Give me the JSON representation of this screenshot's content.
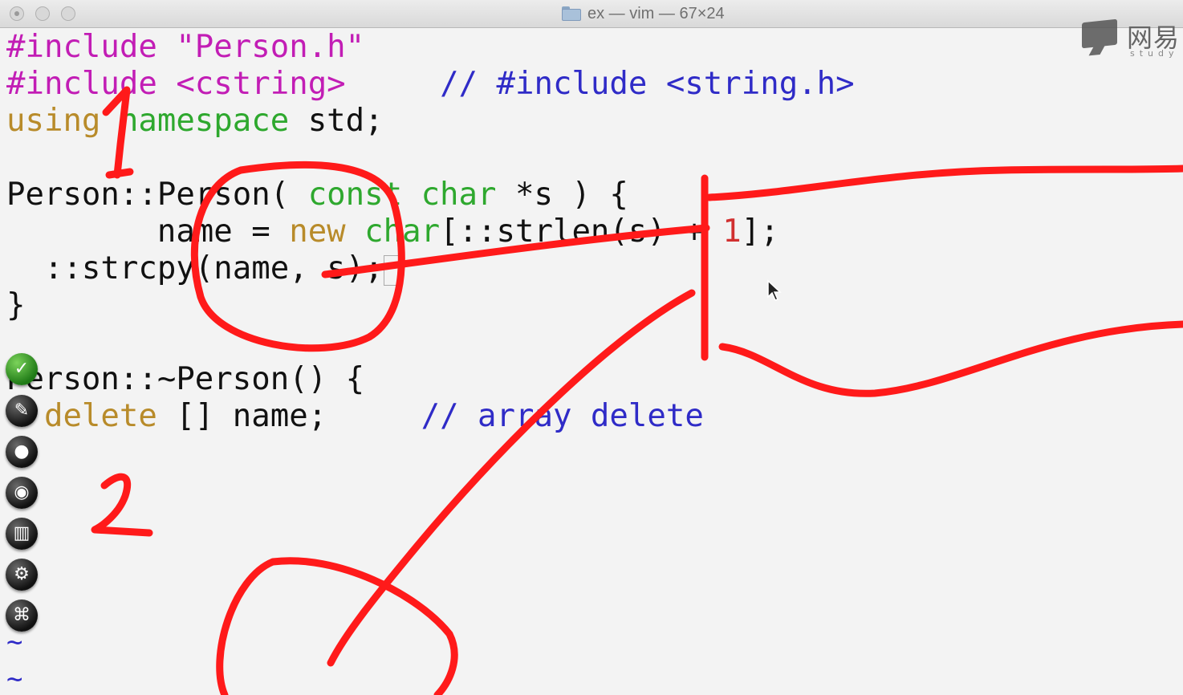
{
  "window": {
    "title": "ex — vim — 67×24"
  },
  "watermark": {
    "brand": "网易",
    "sub": "study"
  },
  "code": {
    "line1": {
      "pre": "#include",
      "str": "\"Person.h\""
    },
    "line2": {
      "pre": "#include",
      "str": "<cstring>",
      "comment": "// #include <string.h>"
    },
    "line3": {
      "kw": "using",
      "type": "namespace",
      "rest": "std;"
    },
    "line5": {
      "a": "Person::Person(",
      "kw1": "const",
      "kw2": "char",
      "rest": "*s ) {"
    },
    "line6": {
      "a": "name = ",
      "kw": "new",
      "type": "char",
      "b": "[::strlen(s) + ",
      "num": "1",
      "c": "];"
    },
    "line7": {
      "a": "::strcpy(name, s);"
    },
    "line8": {
      "a": "}"
    },
    "line10": {
      "a": "Person::~Person() {"
    },
    "line11": {
      "kw": "delete",
      "rest": "[] name;",
      "comment": "// array delete"
    },
    "tilde": "~"
  },
  "dock": {
    "icons": [
      "check-icon",
      "pen-icon",
      "drop-icon",
      "eye-icon",
      "trash-icon",
      "gear-icon",
      "command-icon"
    ]
  },
  "annotations": {
    "label_1": "1",
    "label_2": "2",
    "stroke_color": "#ff1a1a"
  },
  "colors": {
    "preprocessor": "#c21db5",
    "keyword": "#b88b2a",
    "type": "#2ea82e",
    "comment": "#2f2bc7",
    "number": "#d13030"
  }
}
